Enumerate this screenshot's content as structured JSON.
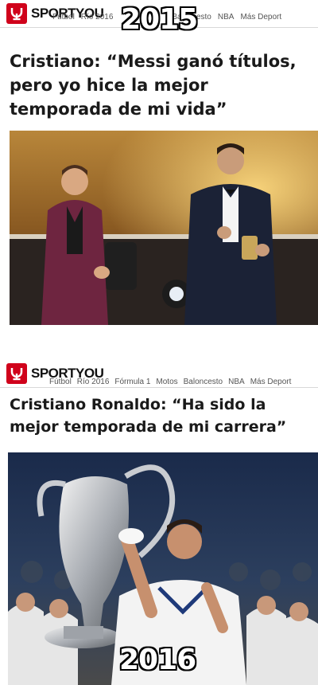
{
  "top": {
    "site": "SPORTYOU",
    "nav": [
      "Fútbol",
      "Río 2016",
      "Baloncesto",
      "NBA",
      "Más Deport"
    ],
    "year": "2015",
    "headline": "Cristiano: “Messi ganó títulos, pero yo hice la mejor temporada de mi vida”"
  },
  "bottom": {
    "site": "SPORTYOU",
    "nav": [
      "Fútbol",
      "Río 2016",
      "Fórmula 1",
      "Motos",
      "Baloncesto",
      "NBA",
      "Más Deport"
    ],
    "year": "2016",
    "headline": "Cristiano Ronaldo: “Ha sido la mejor temporada de mi carrera”"
  },
  "colors": {
    "brand": "#d0021b"
  }
}
